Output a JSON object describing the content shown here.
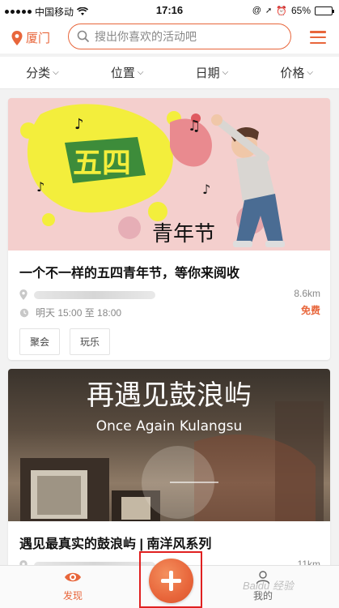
{
  "status_bar": {
    "carrier": "中国移动",
    "time": "17:16",
    "battery_text": "65%",
    "battery_level": 0.65
  },
  "header": {
    "city": "厦门",
    "search_placeholder": "搜出你喜欢的活动吧"
  },
  "filters": [
    {
      "label": "分类"
    },
    {
      "label": "位置"
    },
    {
      "label": "日期"
    },
    {
      "label": "价格"
    }
  ],
  "events": [
    {
      "banner_title": "五四",
      "banner_subtitle": "青年节",
      "title": "一个不一样的五四青年节，等你来阅收",
      "time": "明天 15:00 至 18:00",
      "distance": "8.6km",
      "price": "免费",
      "tags": [
        "聚会",
        "玩乐"
      ]
    },
    {
      "banner_title": "再遇见鼓浪屿",
      "banner_subtitle": "Once Again Kulangsu",
      "title": "遇见最真实的鼓浪屿 | 南洋风系列",
      "distance": "11km"
    }
  ],
  "bottom_nav": {
    "discover": "发现",
    "mine": "我的"
  },
  "watermark": "Baidu 经验",
  "colors": {
    "accent": "#e8663b",
    "highlight_border": "#e02020"
  }
}
